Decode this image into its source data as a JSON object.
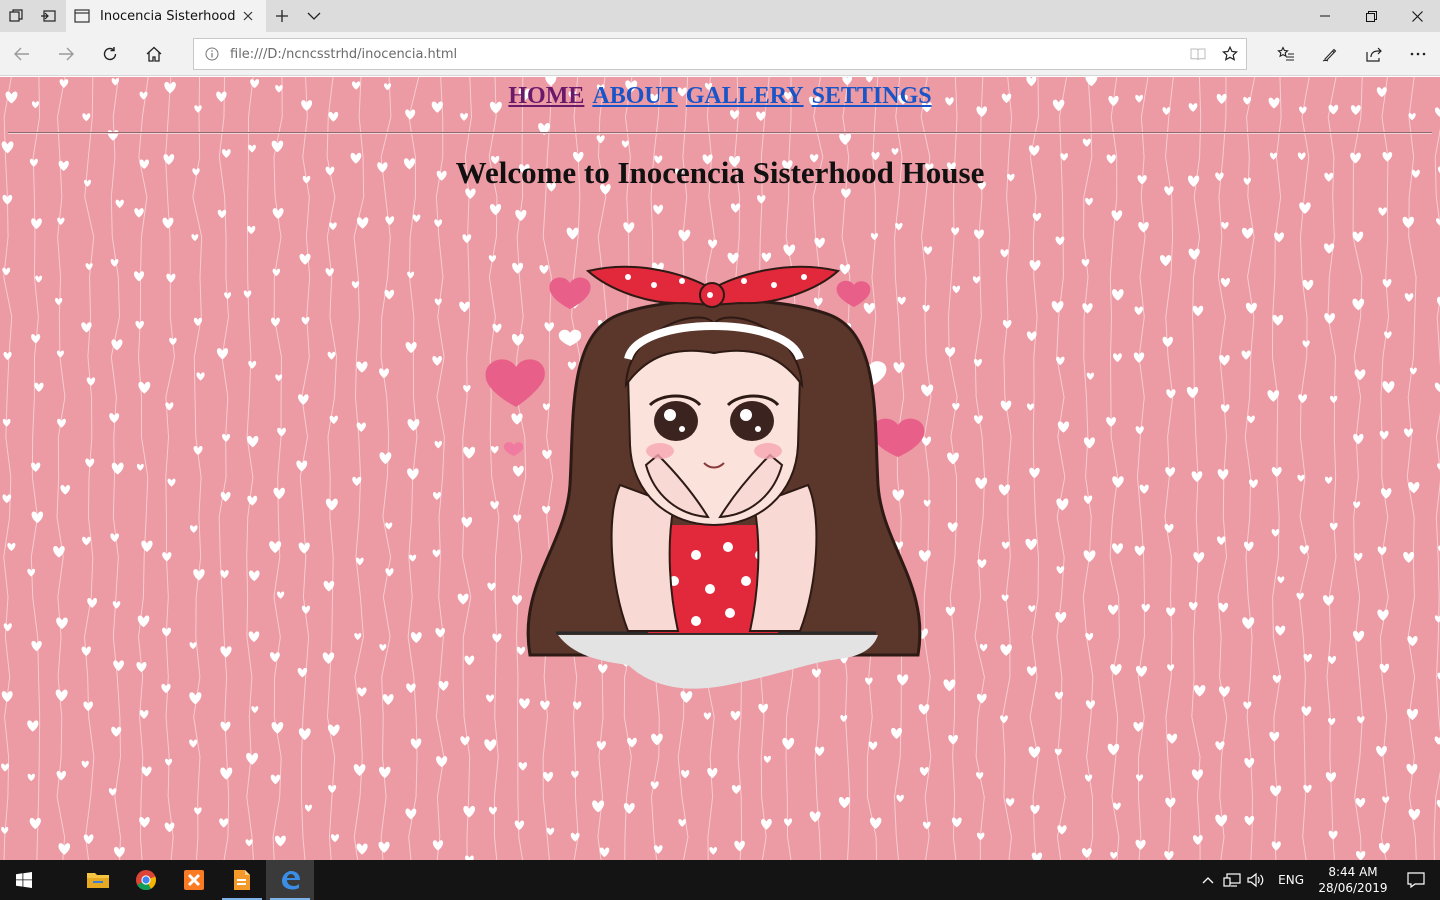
{
  "browser": {
    "tab_title": "Inocencia Sisterhood",
    "address": "file:///D:/ncncsstrhd/inocencia.html"
  },
  "page": {
    "nav": {
      "home": "HOME",
      "about": "ABOUT",
      "gallery": "GALLERY",
      "settings": "SETTINGS"
    },
    "heading": "Welcome to Inocencia Sisterhood House"
  },
  "taskbar": {
    "language": "ENG",
    "time": "8:44 AM",
    "date": "28/06/2019"
  },
  "colors": {
    "page_background": "#ec9aa3",
    "link": "#1a55c7",
    "visited_link": "#6b1a6b"
  }
}
